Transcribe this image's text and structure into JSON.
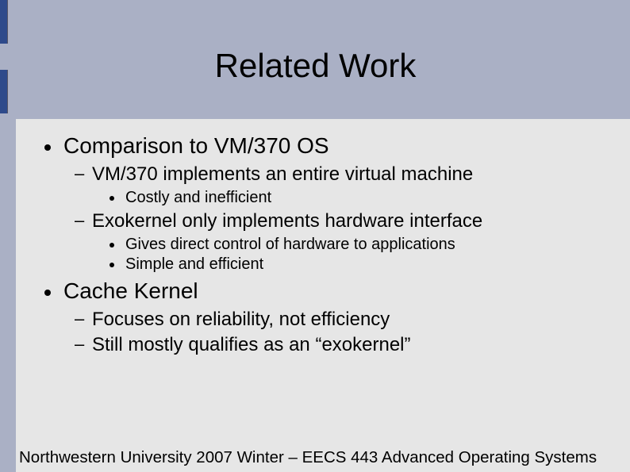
{
  "title": "Related Work",
  "outline": [
    {
      "text": "Comparison to VM/370 OS",
      "children": [
        {
          "text": "VM/370 implements an entire virtual machine",
          "children": [
            {
              "text": "Costly and inefficient"
            }
          ]
        },
        {
          "text": "Exokernel only implements hardware interface",
          "children": [
            {
              "text": "Gives direct control of hardware to applications"
            },
            {
              "text": "Simple and efficient"
            }
          ]
        }
      ]
    },
    {
      "text": "Cache Kernel",
      "children": [
        {
          "text": "Focuses on reliability, not efficiency"
        },
        {
          "text": "Still mostly qualifies as an “exokernel”"
        }
      ]
    }
  ],
  "footer": "Northwestern University 2007 Winter – EECS 443 Advanced Operating Systems"
}
